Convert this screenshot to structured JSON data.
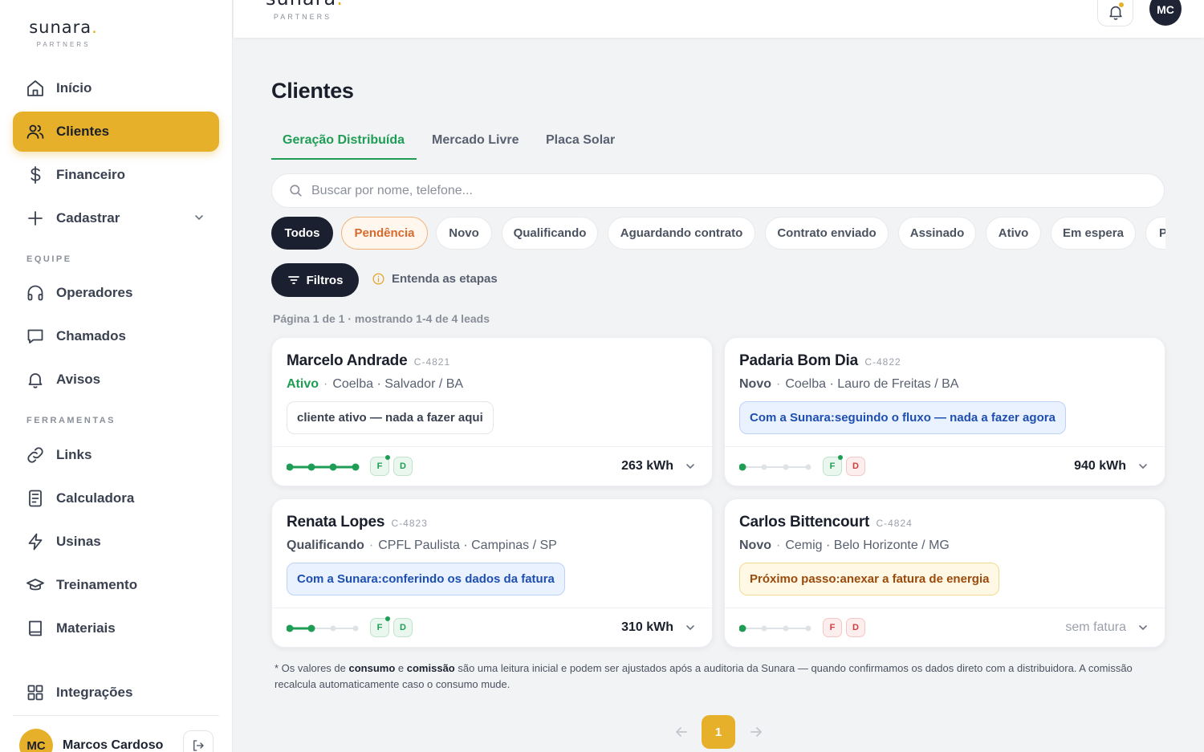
{
  "brand": {
    "word_pre": "sunara",
    "word_dot": ".",
    "sub": "PARTNERS",
    "accent": "#e6b02a"
  },
  "sidebar": {
    "items": [
      {
        "label": "Início",
        "icon": "home-icon"
      },
      {
        "label": "Clientes",
        "icon": "users-icon",
        "active": true
      },
      {
        "label": "Financeiro",
        "icon": "dollar-icon"
      },
      {
        "label": "Cadastrar",
        "icon": "plus-icon"
      }
    ],
    "section_team": "EQUIPE",
    "team_items": [
      {
        "label": "Operadores",
        "icon": "headset-icon"
      },
      {
        "label": "Chamados",
        "icon": "chat-icon"
      },
      {
        "label": "Avisos",
        "icon": "bell-icon"
      }
    ],
    "section_tools": "FERRAMENTAS",
    "tool_items": [
      {
        "label": "Links",
        "icon": "link-icon"
      },
      {
        "label": "Calculadora",
        "icon": "calculator-icon"
      },
      {
        "label": "Usinas",
        "icon": "bolt-icon"
      },
      {
        "label": "Treinamento",
        "icon": "graduation-cap-icon"
      },
      {
        "label": "Materiais",
        "icon": "book-icon"
      }
    ],
    "integrations": "Integrações",
    "user": {
      "initials": "MC",
      "name": "Marcos Cardoso"
    }
  },
  "topbar": {
    "avatar_initials": "MC"
  },
  "main": {
    "title": "Clientes",
    "tabs": [
      "Geração Distribuída",
      "Mercado Livre",
      "Placa Solar"
    ],
    "search_placeholder": "Buscar por nome, telefone...",
    "chips": [
      "Todos",
      "Pendência",
      "Novo",
      "Qualificando",
      "Aguardando contrato",
      "Contrato enviado",
      "Assinado",
      "Ativo",
      "Em espera",
      "P"
    ],
    "filters_label": "Filtros",
    "stages_label": "Entenda as etapas",
    "page_info": "Página 1 de 1 · mostrando 1-4 de 4 leads",
    "pagination": {
      "current": "1"
    }
  },
  "cards": [
    {
      "name": "Marcelo Andrade",
      "code": "C-4821",
      "status": "Ativo",
      "location": "Coelba · Salvador / BA",
      "note_lead": "",
      "note_text": "cliente ativo — nada a fazer aqui",
      "note_style": "plain",
      "progress": 4,
      "badge_f": "F",
      "badge_d": "D",
      "kwh": "263 kWh"
    },
    {
      "name": "Padaria Bom Dia",
      "code": "C-4822",
      "status": "Novo",
      "location": "Coelba · Lauro de Freitas / BA",
      "note_lead": "Com a Sunara:",
      "note_text": " seguindo o fluxo — nada a fazer agora",
      "note_style": "blue",
      "progress": 1,
      "badge_f": "F",
      "badge_d": "D",
      "kwh": "940 kWh"
    },
    {
      "name": "Renata Lopes",
      "code": "C-4823",
      "status": "Qualificando",
      "location": "CPFL Paulista · Campinas / SP",
      "note_lead": "Com a Sunara:",
      "note_text": " conferindo os dados da fatura",
      "note_style": "blue",
      "progress": 2,
      "badge_f": "F",
      "badge_d": "D",
      "kwh": "310 kWh"
    },
    {
      "name": "Carlos Bittencourt",
      "code": "C-4824",
      "status": "Novo",
      "location": "Cemig · Belo Horizonte / MG",
      "note_lead": "Próximo passo:",
      "note_text": " anexar a fatura de energia",
      "note_style": "yellow",
      "progress": 1,
      "badge_f": "F",
      "badge_d": "D",
      "kwh": "sem fatura"
    }
  ],
  "footnote": {
    "p1": "* Os valores de ",
    "b1": "consumo",
    "p2": " e ",
    "b2": "comissão",
    "p3": " são uma leitura inicial e podem ser ajustados após a auditoria da Sunara — quando confirmamos os dados direto com a distribuidora. A comissão recalcula automaticamente caso o consumo mude."
  }
}
